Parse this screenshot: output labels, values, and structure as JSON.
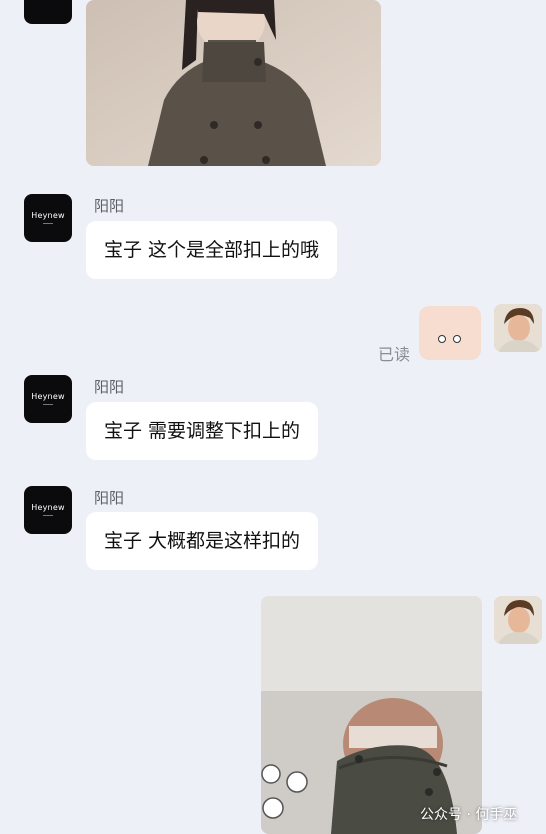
{
  "messages": [
    {
      "sender": "阳阳",
      "avatar_logo": "Heynew",
      "text": "宝子 这个是全部扣上的哦"
    },
    {
      "sender": "阳阳",
      "avatar_logo": "Heynew",
      "text": "宝子 需要调整下扣上的"
    },
    {
      "sender": "阳阳",
      "avatar_logo": "Heynew",
      "text": "宝子 大概都是这样扣的"
    }
  ],
  "read_status": "已读",
  "watermark": "公众号 · 何手巫",
  "colors": {
    "background": "#eef0f7",
    "bubble": "#ffffff",
    "brand_avatar": "#0b0b0d",
    "coat": "#5a5248"
  }
}
